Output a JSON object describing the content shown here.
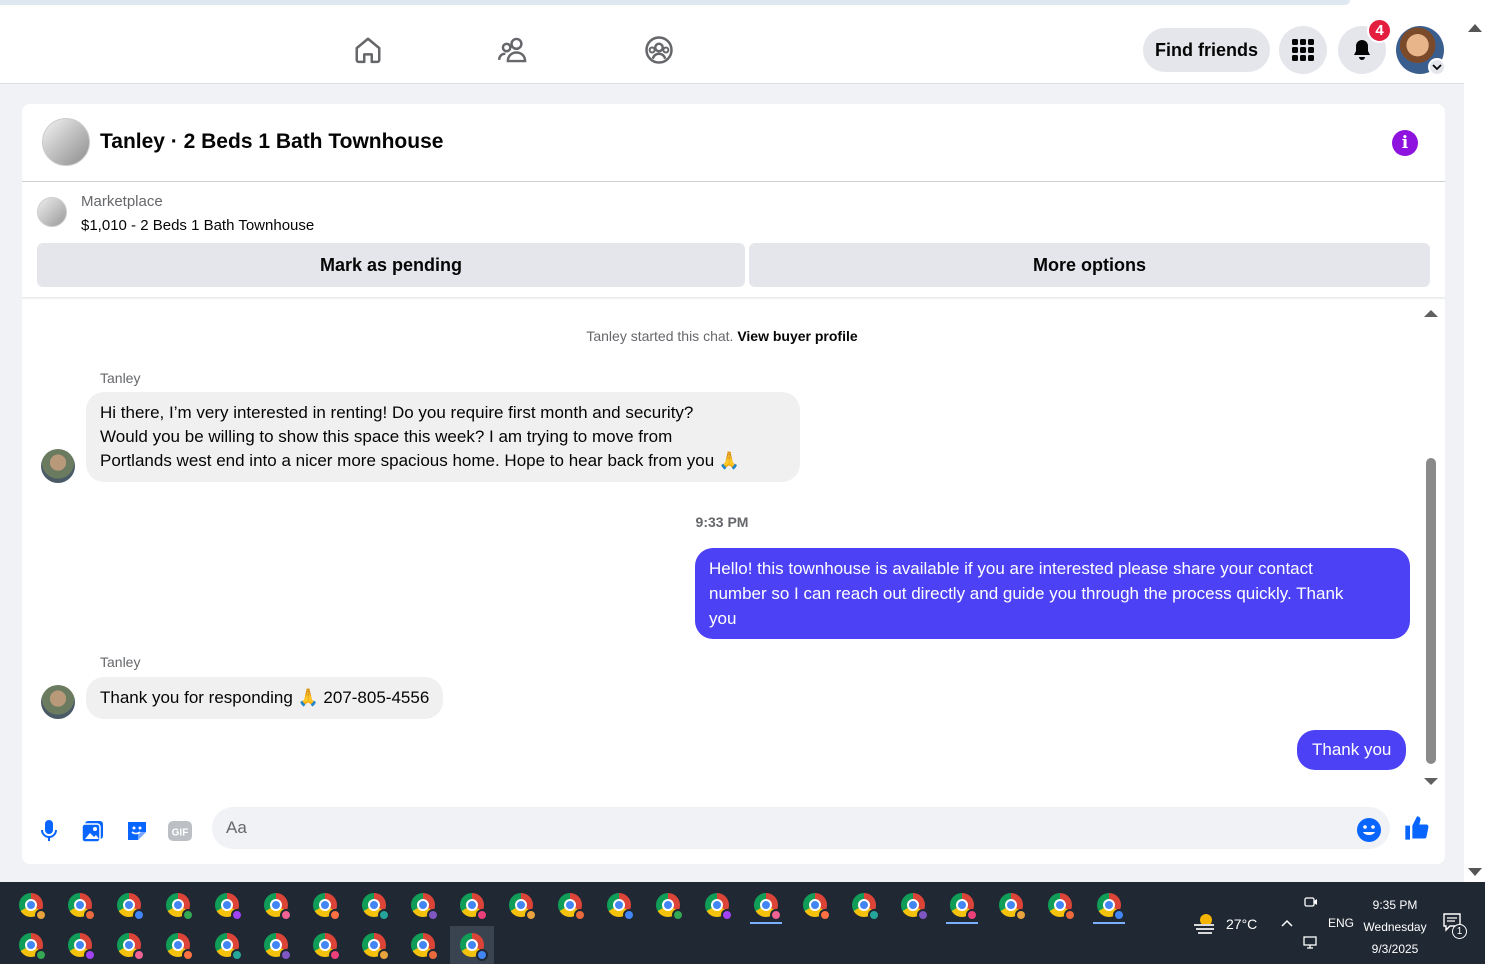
{
  "nav": {
    "find_friends_label": "Find friends",
    "notification_count": "4"
  },
  "chat": {
    "title": "Tanley · 2 Beds 1 Bath Townhouse",
    "marketplace_label": "Marketplace",
    "listing": "$1,010 - 2 Beds 1 Bath Townhouse",
    "mark_pending_label": "Mark as pending",
    "more_options_label": "More options",
    "started_text": "Tanley started this chat.",
    "view_buyer_profile": "View buyer profile",
    "messages": [
      {
        "sender": "Tanley",
        "lines": [
          "Hi there, I’m very interested in renting! Do you require first month and security?",
          "Would you be willing to show this space this week?  I am trying to move from",
          "Portlands west end into a nicer more spacious home. Hope to hear back from you 🙏"
        ]
      },
      {
        "timestamp": "9:33 PM",
        "lines": [
          "Hello! this townhouse is available if you are interested please share your contact",
          "number so I can reach out directly and guide you through the process quickly. Thank",
          "you"
        ]
      },
      {
        "sender": "Tanley",
        "lines": [
          "Thank you for responding 🙏 207-805-4556"
        ]
      },
      {
        "lines": [
          "Thank you"
        ]
      }
    ],
    "input_placeholder": "Aa"
  },
  "tray": {
    "temperature": "27°C",
    "language": "ENG",
    "time": "9:35 PM",
    "day": "Wednesday",
    "date": "9/3/2025",
    "notification_count": "1"
  },
  "colors": {
    "outgoing_bubble": "#4c41f5",
    "accent": "#0866ff",
    "badge": "#e41e3f",
    "info": "#8f13de"
  }
}
